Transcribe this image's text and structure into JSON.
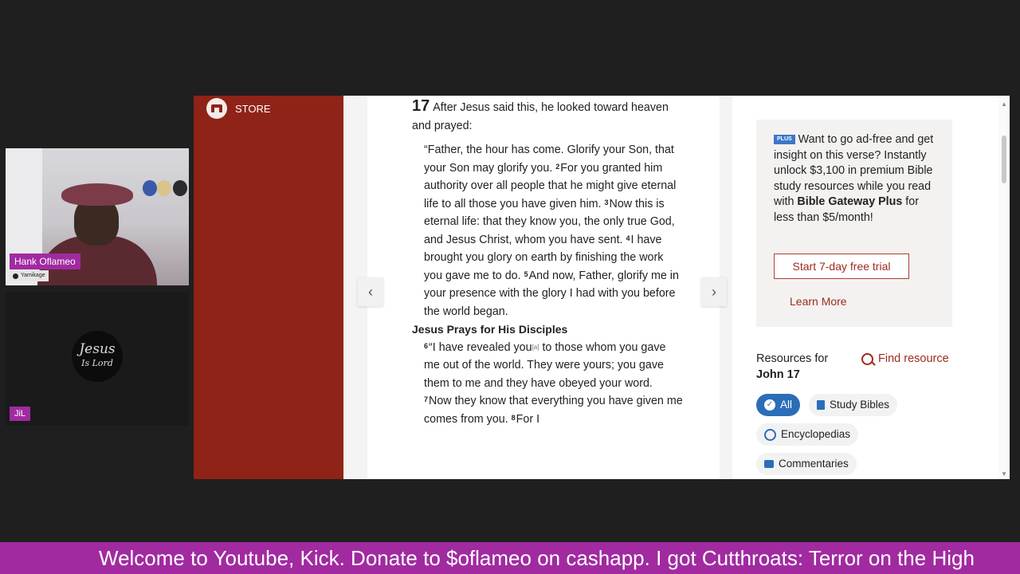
{
  "stream": {
    "webcam_name": "Hank Oflameo",
    "webcam_tag": "Yamikage",
    "guest_label": "JiL",
    "logo_line1": "Jesus",
    "logo_line2": "Is Lord"
  },
  "store": {
    "label": "STORE"
  },
  "reader": {
    "chapter_number": "17",
    "intro": "After Jesus said this, he looked toward heaven and prayed:",
    "prayer_segments": [
      {
        "vn": "",
        "text": "“Father, the hour has come. Glorify your Son, that your Son may glorify you. "
      },
      {
        "vn": "2",
        "text": "For you granted him authority over all people that he might give eternal life to all those you have given him. "
      },
      {
        "vn": "3",
        "text": "Now this is eternal life: that they know you, the only true God, and Jesus Christ, whom you have sent. "
      },
      {
        "vn": "4",
        "text": "I have brought you glory on earth by finishing the work you gave me to do. "
      },
      {
        "vn": "5",
        "text": "And now, Father, glorify me in your presence with the glory I had with you before the world began."
      }
    ],
    "heading": "Jesus Prays for His Disciples",
    "disciples_v6_pre": "“I have revealed you",
    "footnote": "[a]",
    "disciples_v6_post": " to those whom you gave me out of the world. They were yours; you gave them to me and they have obeyed your word. ",
    "v7": "Now they know that everything you have given me comes from you. ",
    "v8": "For I",
    "vn6": "6",
    "vn7": "7",
    "vn8": "8",
    "prev_arrow": "‹",
    "next_arrow": "›"
  },
  "sidebar": {
    "plus_badge": "PLUS",
    "plus_text": "Want to go ad-free and get insight on this verse? Instantly unlock $3,100 in premium Bible study resources while you read with ",
    "plus_brand": "Bible Gateway Plus",
    "plus_tail": " for less than $5/month!",
    "trial_button": "Start 7-day free trial",
    "learn_more": "Learn More",
    "resources_for": "Resources for",
    "resources_ref": "John 17",
    "find_resource": "Find resource",
    "chips": {
      "all": "All",
      "study_bibles": "Study Bibles",
      "encyclopedias": "Encyclopedias",
      "commentaries": "Commentaries"
    }
  },
  "ticker": {
    "text": "Welcome to Youtube, Kick. Donate to $oflameo on cashapp. I got Cutthroats: Terror on the High"
  },
  "colors": {
    "ticker": "#a12aa1",
    "store": "#8f2317",
    "accent": "#9d2a1e",
    "chip_active": "#2a6eb8"
  }
}
